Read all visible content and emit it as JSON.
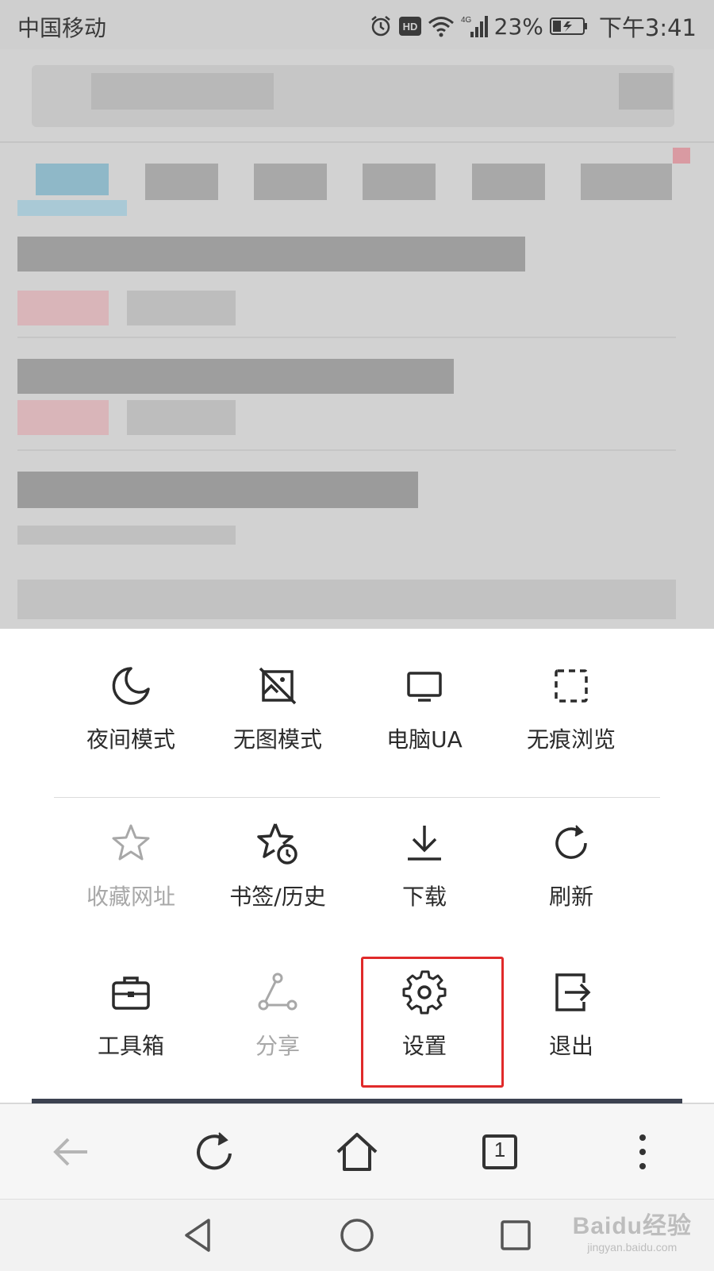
{
  "status_bar": {
    "carrier": "中国移动",
    "network": "4G",
    "battery": "23%",
    "time": "下午3:41",
    "icons": [
      "alarm-icon",
      "hd-icon",
      "wifi-icon",
      "signal-icon",
      "battery-icon"
    ]
  },
  "menu": {
    "rows": [
      [
        {
          "label": "夜间模式",
          "icon": "moon-icon",
          "disabled": false
        },
        {
          "label": "无图模式",
          "icon": "no-image-icon",
          "disabled": false
        },
        {
          "label": "电脑UA",
          "icon": "desktop-icon",
          "disabled": false
        },
        {
          "label": "无痕浏览",
          "icon": "dashed-square-icon",
          "disabled": false
        }
      ],
      [
        {
          "label": "收藏网址",
          "icon": "star-icon",
          "disabled": true
        },
        {
          "label": "书签/历史",
          "icon": "star-clock-icon",
          "disabled": false
        },
        {
          "label": "下载",
          "icon": "download-icon",
          "disabled": false
        },
        {
          "label": "刷新",
          "icon": "refresh-icon",
          "disabled": false
        }
      ],
      [
        {
          "label": "工具箱",
          "icon": "toolbox-icon",
          "disabled": false
        },
        {
          "label": "分享",
          "icon": "share-icon",
          "disabled": true
        },
        {
          "label": "设置",
          "icon": "gear-icon",
          "disabled": false
        },
        {
          "label": "退出",
          "icon": "exit-icon",
          "disabled": false
        }
      ]
    ],
    "highlighted_item": "设置",
    "highlight_color": "#e02a2a"
  },
  "toolbar": {
    "items": [
      "back-arrow-icon",
      "refresh-icon",
      "home-icon",
      "tabs-icon",
      "more-icon"
    ],
    "tab_count": "1"
  },
  "system_nav": {
    "items": [
      "back-triangle-icon",
      "home-circle-icon",
      "recent-square-icon"
    ]
  },
  "watermark": {
    "main": "Baidu经验",
    "sub": "jingyan.baidu.com"
  }
}
